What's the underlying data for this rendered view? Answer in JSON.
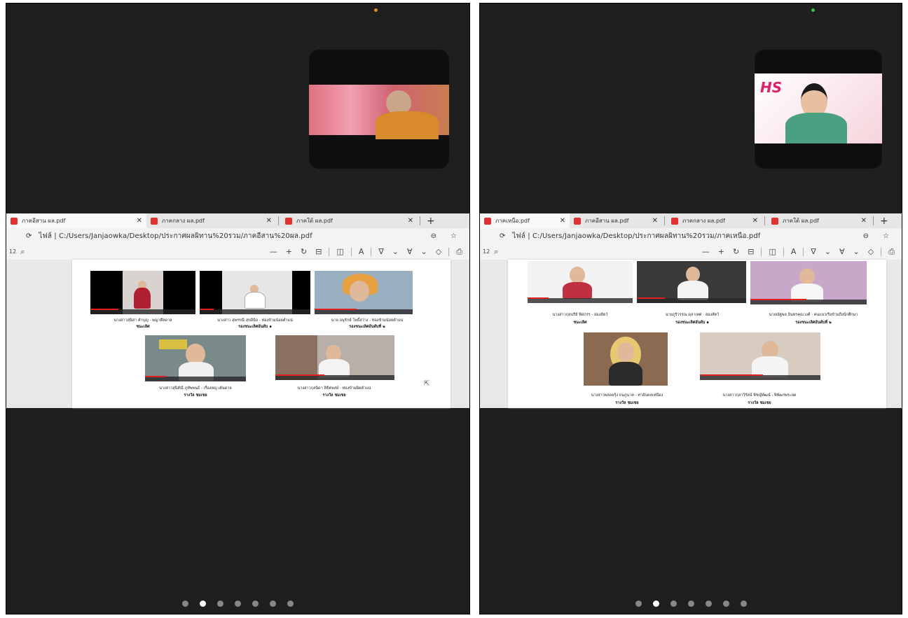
{
  "panels": [
    {
      "indicator_color": "#e08a2a",
      "tabs": [
        {
          "label": "ภาคอีสาน ผล.pdf",
          "active": true
        },
        {
          "label": "ภาคกลาง ผล.pdf",
          "active": false
        },
        {
          "label": "ภาคใต้ ผล.pdf",
          "active": false
        }
      ],
      "address": "ไฟล์  |  C:/Users/Janjaowka/Desktop/ประกาศผลผิทาน%20รวม/ภาคอีสาน%20ผล.pdf",
      "page_left_num": "12",
      "captions": [
        "นางสาวสุนิสา คำบุญ - พญาศีลดาล",
        "นางสาว สุพรรณี สุขอินิจ - ท่องข้ามน้อยตำแน่",
        "นาย อนุรักษ์ โพธิ์สว่าง - ท่องข้ามน้อยตำแน่",
        "นางสาวสุนิสัณี ภูทัพพนธ์ - เรื่องหญ เต้นดาล",
        "นางสาวกุลนิดา ลิขิตพงษ์ - ท่องข้ามผิดตำแน่"
      ],
      "awards": [
        "ชนะเลิศ",
        "รองชนะเลิศอันดับ ๑",
        "รองชนะเลิศอันดับที่ ๒",
        "รางวัล ชมเชย",
        "รางวัล ชมเชย"
      ]
    },
    {
      "indicator_color": "#3ac04a",
      "tabs": [
        {
          "label": "ภาคเหนือ.pdf",
          "active": true
        },
        {
          "label": "ภาคอีสาน ผล.pdf",
          "active": false
        },
        {
          "label": "ภาคกลาง ผล.pdf",
          "active": false
        },
        {
          "label": "ภาคใต้ ผล.pdf",
          "active": false
        }
      ],
      "address": "ไฟล์  |  C:/Users/Janjaowka/Desktop/ประกาศผลผิทาน%20รวม/ภาคเหนือ.pdf",
      "page_left_num": "12",
      "pip_logo": "HS",
      "captions": [
        "นางสาวกุลนรีย์ ฟิสกรร - สองสัตว์",
        "นายภูริวรรณ ดุลาเทศ - สองสัตว์",
        "นายณัฐพล อินทรคุณวงศ์ - คนแจวเรือข้ามถึงนักศึกษา",
        "นางสาวพลอยรุ้ง ธนภูนาค - ท่าอันดลเหนือง",
        "นางสาวกุลาวิรัลน์ พิชญ์พัฒน์ - พิพัฒรพระยด"
      ],
      "awards": [
        "ชนะเลิศ",
        "รองชนะเลิศอันดับ ๑",
        "รองชนะเลิศอันดับที่ ๒",
        "รางวัล ชมเชย",
        "รางวัล ชมเชย"
      ]
    }
  ],
  "pager": {
    "count": 7,
    "active_index": 1
  }
}
